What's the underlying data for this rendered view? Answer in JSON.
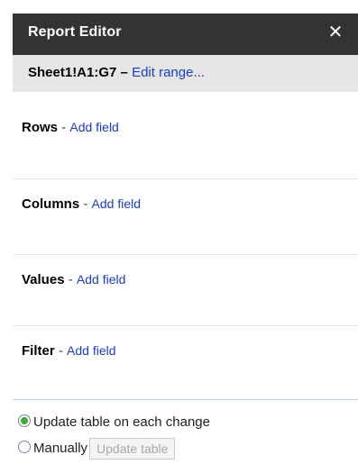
{
  "header": {
    "title": "Report Editor",
    "close_glyph": "✕"
  },
  "range": {
    "value": "Sheet1!A1:G7",
    "separator": " – ",
    "edit_link": "Edit range..."
  },
  "sections": [
    {
      "label": "Rows",
      "separator": " - ",
      "add_link": "Add field"
    },
    {
      "label": "Columns",
      "separator": " - ",
      "add_link": "Add field"
    },
    {
      "label": "Values",
      "separator": " - ",
      "add_link": "Add field"
    },
    {
      "label": "Filter",
      "separator": " - ",
      "add_link": "Add field"
    }
  ],
  "update_options": {
    "auto_label": "Update table on each change",
    "manual_label": "Manually",
    "selected": "auto",
    "update_button": "Update table"
  }
}
